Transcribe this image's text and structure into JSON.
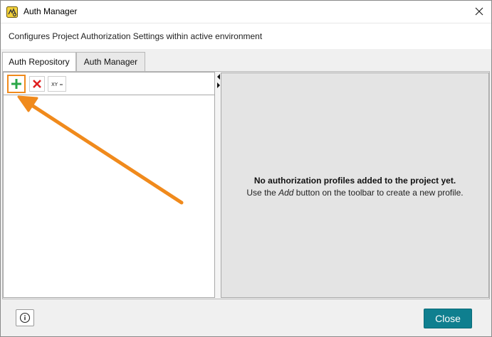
{
  "window": {
    "title": "Auth Manager",
    "description": "Configures Project Authorization Settings within active environment"
  },
  "tabs": [
    {
      "label": "Auth Repository",
      "active": true
    },
    {
      "label": "Auth Manager",
      "active": false
    }
  ],
  "toolbar": {
    "add_icon": "plus-icon",
    "delete_icon": "delete-x-icon",
    "xy_label": "XY",
    "xy_icon": "xy-rename-icon"
  },
  "right_pane": {
    "empty_title": "No authorization profiles added to the project yet.",
    "hint_prefix": "Use the ",
    "hint_emphasis": "Add",
    "hint_suffix": " button on the toolbar to create a new profile."
  },
  "footer": {
    "close_label": "Close",
    "info_icon": "info-icon"
  },
  "colors": {
    "accent": "#0f7f8f",
    "annotation_arrow": "#f08a1c",
    "add_green": "#2aa748",
    "delete_red": "#e02020"
  }
}
